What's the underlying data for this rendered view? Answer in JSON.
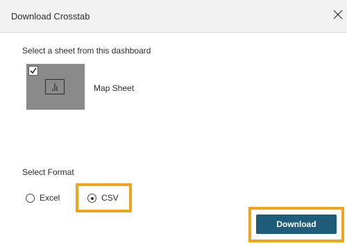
{
  "dialog": {
    "title": "Download Crosstab",
    "close_icon": "close-icon"
  },
  "sheets": {
    "label": "Select a sheet from this dashboard",
    "items": [
      {
        "name": "Map Sheet",
        "checked": true,
        "icon": "bar-chart-icon"
      }
    ]
  },
  "format": {
    "label": "Select Format",
    "options": [
      {
        "label": "Excel",
        "selected": false
      },
      {
        "label": "CSV",
        "selected": true
      }
    ]
  },
  "actions": {
    "download_label": "Download"
  },
  "colors": {
    "highlight": "#f0a31b",
    "primary_button": "#1f5c7a",
    "thumbnail_bg": "#8a8a8a",
    "titlebar_bg": "#f2f2f2"
  }
}
